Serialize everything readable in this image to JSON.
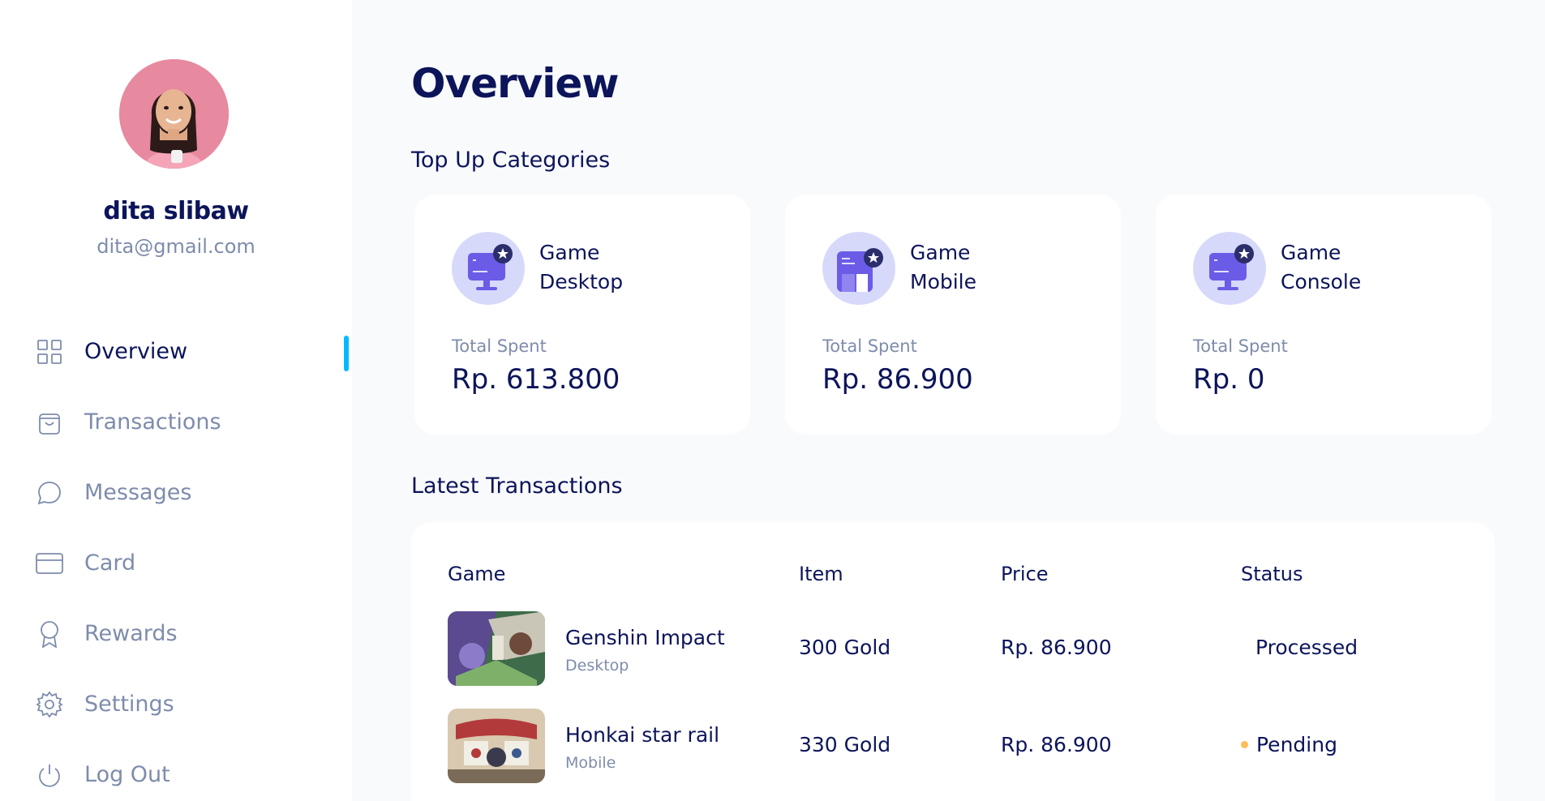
{
  "profile": {
    "name": "dita slibaw",
    "email": "dita@gmail.com"
  },
  "nav": {
    "items": [
      {
        "label": "Overview",
        "icon": "grid-icon",
        "active": true
      },
      {
        "label": "Transactions",
        "icon": "shopping-bag-icon",
        "active": false
      },
      {
        "label": "Messages",
        "icon": "chat-bubble-icon",
        "active": false
      },
      {
        "label": "Card",
        "icon": "credit-card-icon",
        "active": false
      },
      {
        "label": "Rewards",
        "icon": "award-ribbon-icon",
        "active": false
      },
      {
        "label": "Settings",
        "icon": "gear-icon",
        "active": false
      },
      {
        "label": "Log Out",
        "icon": "power-icon",
        "active": false
      }
    ]
  },
  "main": {
    "title": "Overview",
    "categories_title": "Top Up Categories",
    "categories": [
      {
        "line1": "Game",
        "line2": "Desktop",
        "spent_label": "Total Spent",
        "spent_value": "Rp. 613.800",
        "icon": "desktop-monitor-icon"
      },
      {
        "line1": "Game",
        "line2": "Mobile",
        "spent_label": "Total Spent",
        "spent_value": "Rp. 86.900",
        "icon": "mobile-phone-icon"
      },
      {
        "line1": "Game",
        "line2": "Console",
        "spent_label": "Total Spent",
        "spent_value": "Rp. 0",
        "icon": "desktop-monitor-icon"
      }
    ],
    "transactions_title": "Latest Transactions",
    "transactions": {
      "headers": {
        "game": "Game",
        "item": "Item",
        "price": "Price",
        "status": "Status"
      },
      "rows": [
        {
          "game": "Genshin Impact",
          "platform": "Desktop",
          "item": "300 Gold",
          "price": "Rp. 86.900",
          "status": "Processed"
        },
        {
          "game": "Honkai star rail",
          "platform": "Mobile",
          "item": "330 Gold",
          "price": "Rp. 86.900",
          "status": "Pending"
        }
      ]
    }
  },
  "colors": {
    "navy": "#0C145A",
    "muted": "#7E8CAC",
    "accent": "#00BAFF",
    "purple": "#6B5CE7",
    "icon_bg": "#D7D9FB",
    "pending": "#FEBD57",
    "background": "#F9FAFC"
  }
}
